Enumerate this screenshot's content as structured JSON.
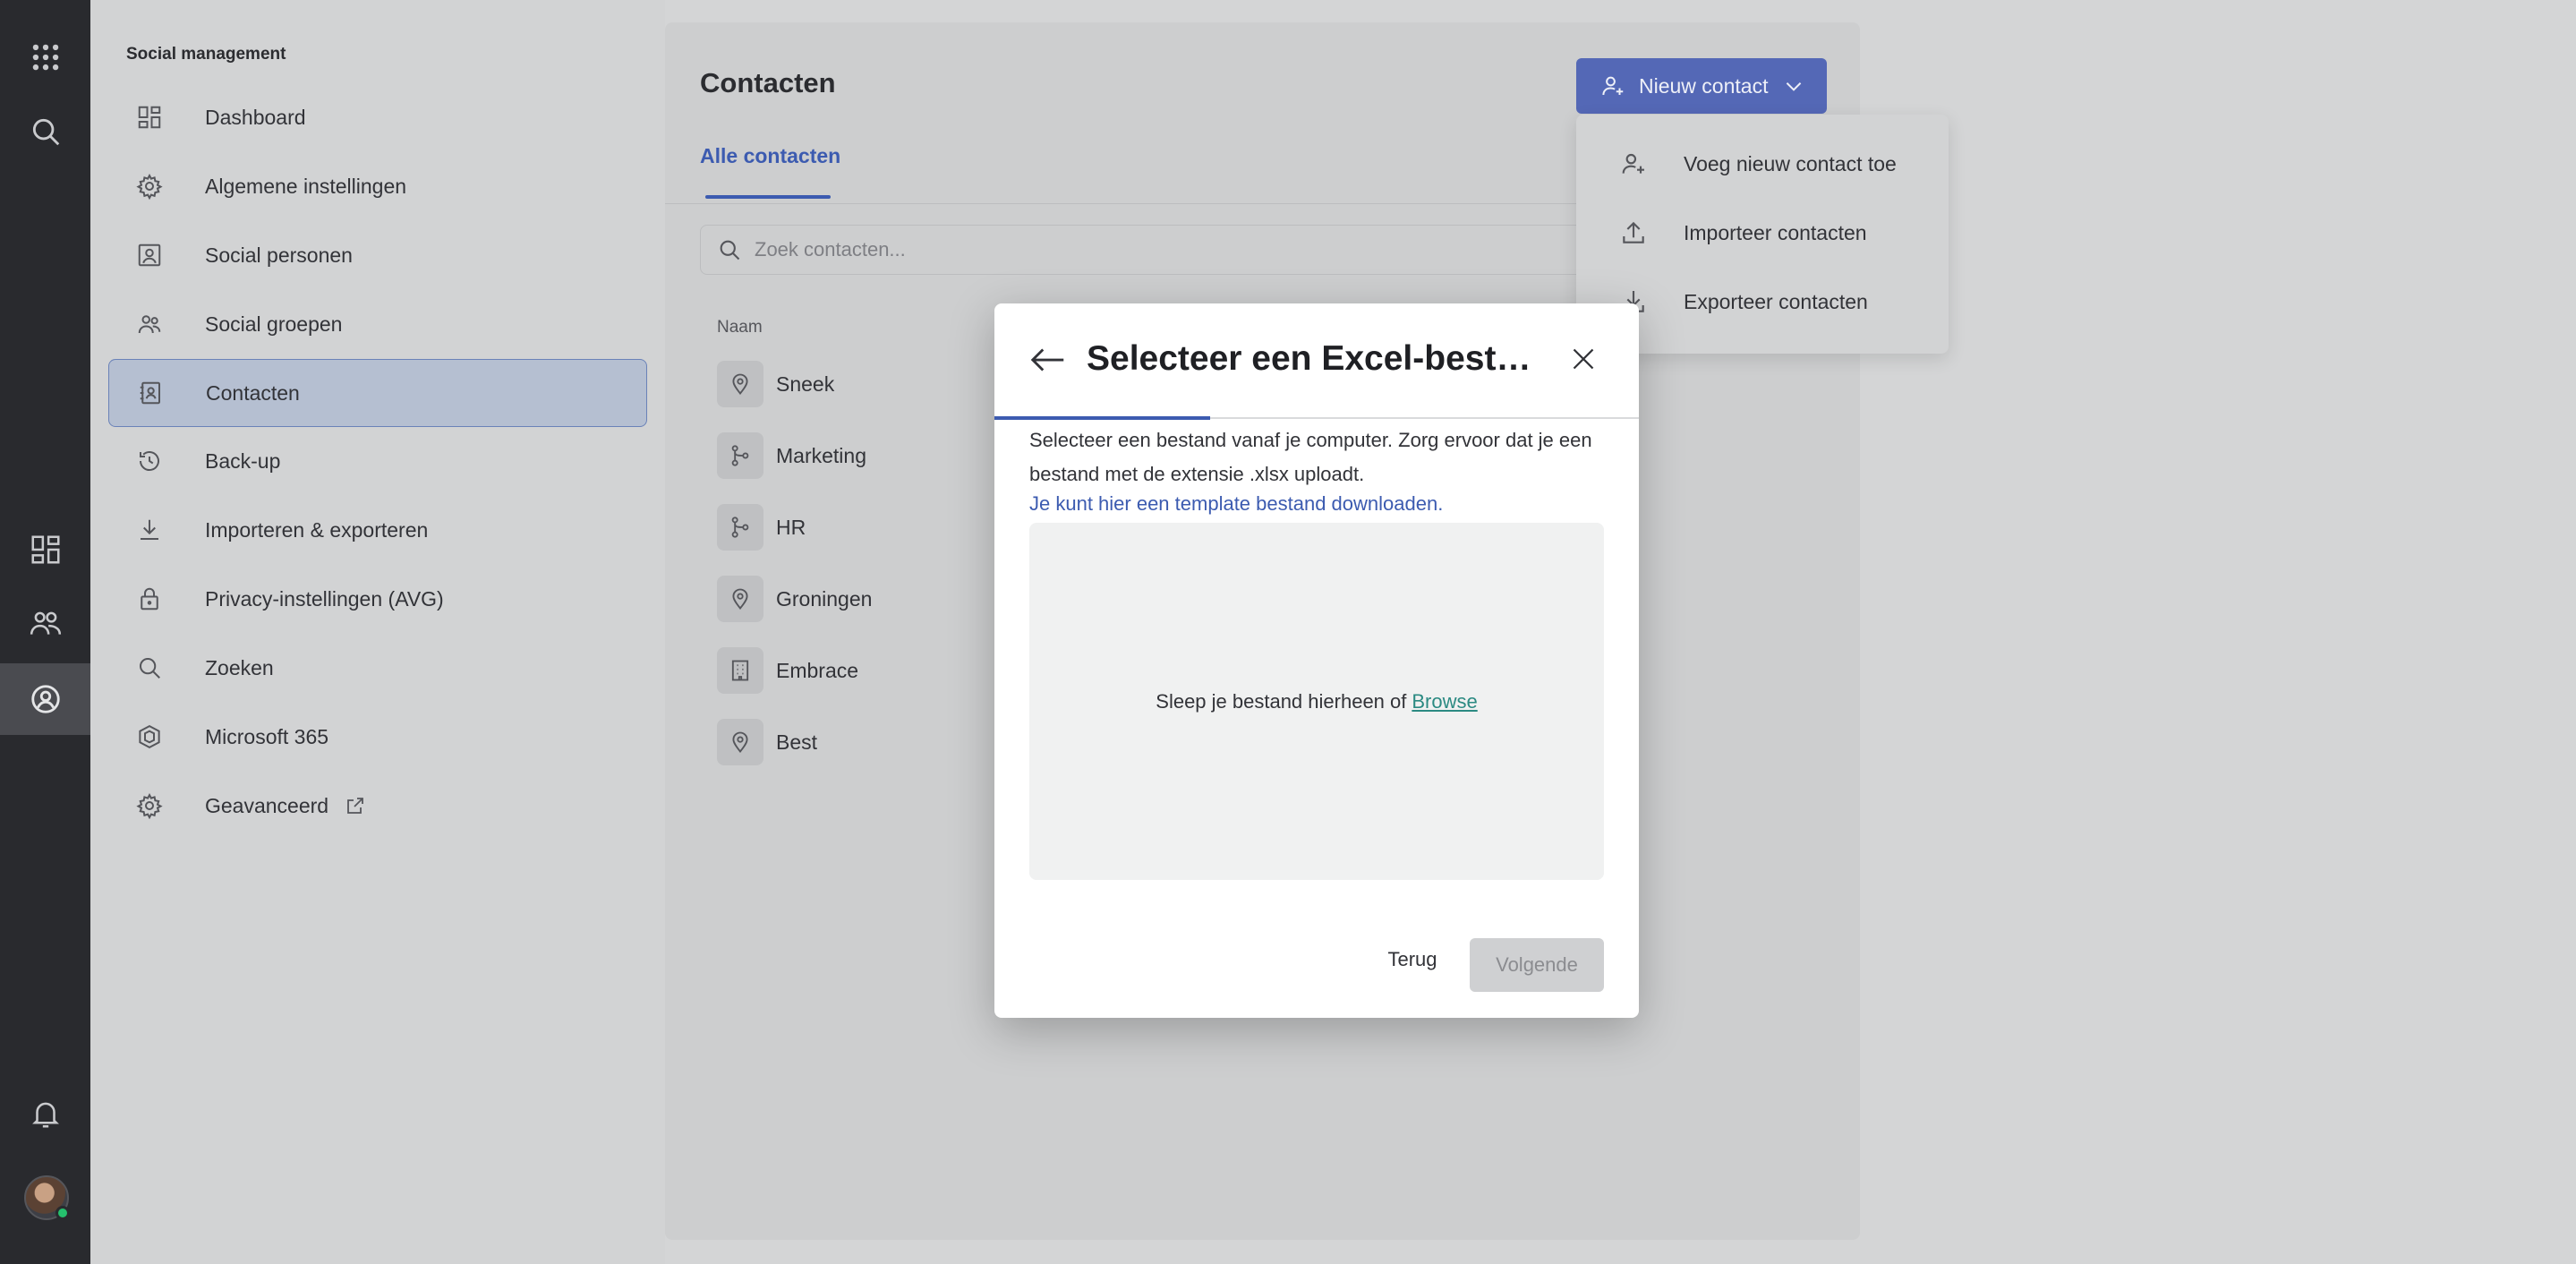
{
  "sidebar": {
    "title": "Social management",
    "items": [
      {
        "label": "Dashboard"
      },
      {
        "label": "Algemene instellingen"
      },
      {
        "label": "Social personen"
      },
      {
        "label": "Social groepen"
      },
      {
        "label": "Contacten"
      },
      {
        "label": "Back-up"
      },
      {
        "label": "Importeren & exporteren"
      },
      {
        "label": "Privacy-instellingen (AVG)"
      },
      {
        "label": "Zoeken"
      },
      {
        "label": "Microsoft 365"
      },
      {
        "label": "Geavanceerd"
      }
    ]
  },
  "main": {
    "title": "Contacten",
    "tab": "Alle contacten",
    "search_placeholder": "Zoek contacten...",
    "column_header": "Naam",
    "rows": [
      {
        "label": "Sneek",
        "icon": "location-icon"
      },
      {
        "label": "Marketing",
        "icon": "branch-icon"
      },
      {
        "label": "HR",
        "icon": "branch-icon"
      },
      {
        "label": "Groningen",
        "icon": "location-icon"
      },
      {
        "label": "Embrace",
        "icon": "building-icon"
      },
      {
        "label": "Best",
        "icon": "location-icon"
      }
    ],
    "new_contact_label": "Nieuw contact"
  },
  "dropdown": {
    "items": [
      {
        "label": "Voeg nieuw contact toe"
      },
      {
        "label": "Importeer contacten"
      },
      {
        "label": "Exporteer contacten"
      }
    ]
  },
  "modal": {
    "title": "Selecteer een Excel-bestand",
    "description": "Selecteer een bestand vanaf je computer. Zorg ervoor dat je een bestand met de extensie .xlsx uploadt.",
    "template_link": "Je kunt hier een template bestand downloaden.",
    "drop_text": "Sleep je bestand hierheen of",
    "browse_label": "Browse",
    "back_label": "Terug",
    "next_label": "Volgende"
  },
  "colors": {
    "accent": "#3c5bb0",
    "primary_button": "#5468b6",
    "browse_link": "#2b8a82"
  }
}
